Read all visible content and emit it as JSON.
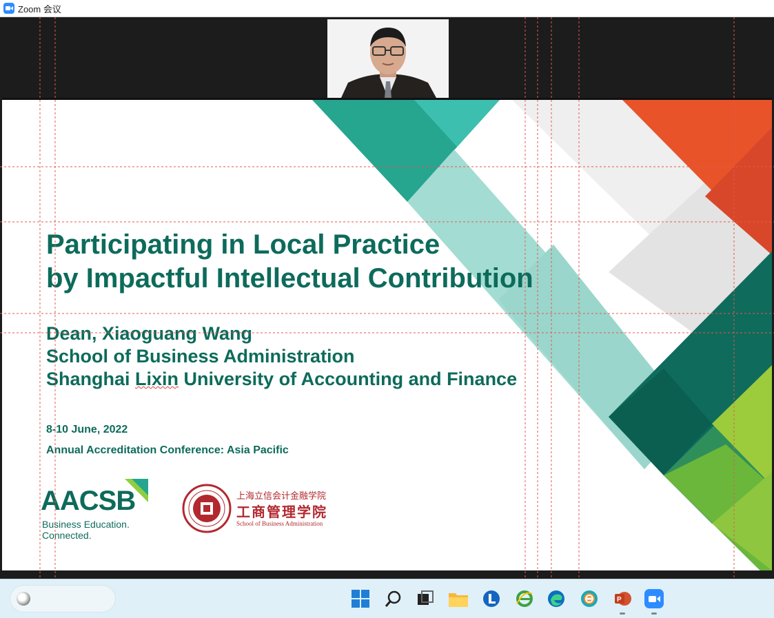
{
  "window": {
    "title": "Zoom 会议"
  },
  "slide": {
    "title_line1": "Participating in Local Practice",
    "title_line2": "by Impactful Intellectual Contribution",
    "presenter_line1": "Dean, Xiaoguang Wang",
    "presenter_line2": "School of Business Administration",
    "presenter_line3_a": "Shanghai ",
    "presenter_line3_b": "Lixin",
    "presenter_line3_c": " University of Accounting and Finance",
    "date": "8-10 June, 2022",
    "conference": "Annual Accreditation Conference: Asia Pacific"
  },
  "logos": {
    "aacsb_wordmark": "AACSB",
    "aacsb_tag1": "Business Education.",
    "aacsb_tag2": "Connected.",
    "lixin_cn_university": "上海立信会计金融学院",
    "lixin_cn_school": "工商管理学院",
    "lixin_en": "School of Business Administration"
  },
  "colors": {
    "brand_green": "#0d6b5b",
    "teal": "#26a58f",
    "light_teal": "#a3dcd3",
    "orange": "#e8532a",
    "lime": "#7cbf3c",
    "seal_red": "#b2282e"
  },
  "taskbar": {
    "icons": [
      "search-box",
      "start-icon",
      "search-icon",
      "task-view-icon",
      "file-explorer-icon",
      "lark-icon",
      "ie-icon",
      "edge-icon",
      "edge-beta-icon",
      "powerpoint-icon",
      "zoom-icon"
    ]
  }
}
